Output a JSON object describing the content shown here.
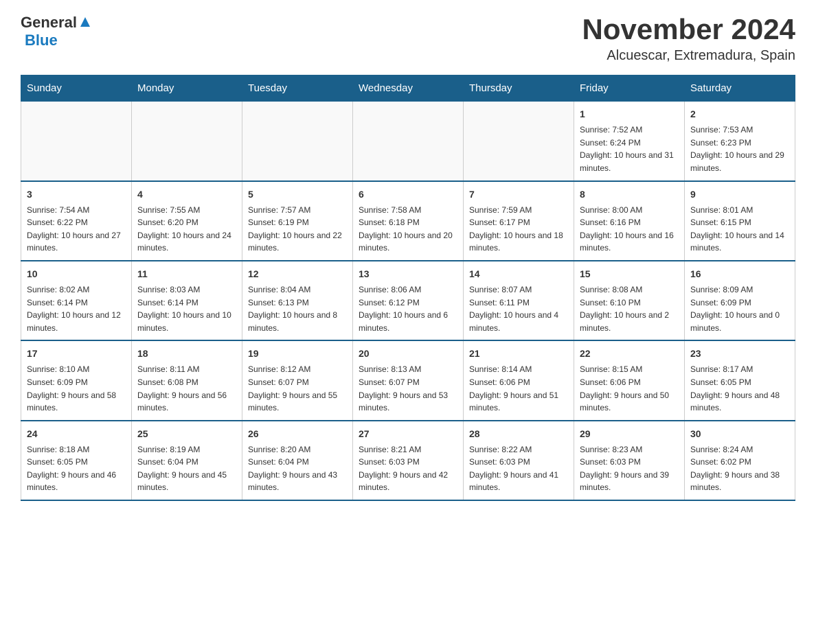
{
  "header": {
    "logo_general": "General",
    "logo_blue": "Blue",
    "title": "November 2024",
    "subtitle": "Alcuescar, Extremadura, Spain"
  },
  "calendar": {
    "days_of_week": [
      "Sunday",
      "Monday",
      "Tuesday",
      "Wednesday",
      "Thursday",
      "Friday",
      "Saturday"
    ],
    "weeks": [
      [
        {
          "day": "",
          "info": ""
        },
        {
          "day": "",
          "info": ""
        },
        {
          "day": "",
          "info": ""
        },
        {
          "day": "",
          "info": ""
        },
        {
          "day": "",
          "info": ""
        },
        {
          "day": "1",
          "info": "Sunrise: 7:52 AM\nSunset: 6:24 PM\nDaylight: 10 hours and 31 minutes."
        },
        {
          "day": "2",
          "info": "Sunrise: 7:53 AM\nSunset: 6:23 PM\nDaylight: 10 hours and 29 minutes."
        }
      ],
      [
        {
          "day": "3",
          "info": "Sunrise: 7:54 AM\nSunset: 6:22 PM\nDaylight: 10 hours and 27 minutes."
        },
        {
          "day": "4",
          "info": "Sunrise: 7:55 AM\nSunset: 6:20 PM\nDaylight: 10 hours and 24 minutes."
        },
        {
          "day": "5",
          "info": "Sunrise: 7:57 AM\nSunset: 6:19 PM\nDaylight: 10 hours and 22 minutes."
        },
        {
          "day": "6",
          "info": "Sunrise: 7:58 AM\nSunset: 6:18 PM\nDaylight: 10 hours and 20 minutes."
        },
        {
          "day": "7",
          "info": "Sunrise: 7:59 AM\nSunset: 6:17 PM\nDaylight: 10 hours and 18 minutes."
        },
        {
          "day": "8",
          "info": "Sunrise: 8:00 AM\nSunset: 6:16 PM\nDaylight: 10 hours and 16 minutes."
        },
        {
          "day": "9",
          "info": "Sunrise: 8:01 AM\nSunset: 6:15 PM\nDaylight: 10 hours and 14 minutes."
        }
      ],
      [
        {
          "day": "10",
          "info": "Sunrise: 8:02 AM\nSunset: 6:14 PM\nDaylight: 10 hours and 12 minutes."
        },
        {
          "day": "11",
          "info": "Sunrise: 8:03 AM\nSunset: 6:14 PM\nDaylight: 10 hours and 10 minutes."
        },
        {
          "day": "12",
          "info": "Sunrise: 8:04 AM\nSunset: 6:13 PM\nDaylight: 10 hours and 8 minutes."
        },
        {
          "day": "13",
          "info": "Sunrise: 8:06 AM\nSunset: 6:12 PM\nDaylight: 10 hours and 6 minutes."
        },
        {
          "day": "14",
          "info": "Sunrise: 8:07 AM\nSunset: 6:11 PM\nDaylight: 10 hours and 4 minutes."
        },
        {
          "day": "15",
          "info": "Sunrise: 8:08 AM\nSunset: 6:10 PM\nDaylight: 10 hours and 2 minutes."
        },
        {
          "day": "16",
          "info": "Sunrise: 8:09 AM\nSunset: 6:09 PM\nDaylight: 10 hours and 0 minutes."
        }
      ],
      [
        {
          "day": "17",
          "info": "Sunrise: 8:10 AM\nSunset: 6:09 PM\nDaylight: 9 hours and 58 minutes."
        },
        {
          "day": "18",
          "info": "Sunrise: 8:11 AM\nSunset: 6:08 PM\nDaylight: 9 hours and 56 minutes."
        },
        {
          "day": "19",
          "info": "Sunrise: 8:12 AM\nSunset: 6:07 PM\nDaylight: 9 hours and 55 minutes."
        },
        {
          "day": "20",
          "info": "Sunrise: 8:13 AM\nSunset: 6:07 PM\nDaylight: 9 hours and 53 minutes."
        },
        {
          "day": "21",
          "info": "Sunrise: 8:14 AM\nSunset: 6:06 PM\nDaylight: 9 hours and 51 minutes."
        },
        {
          "day": "22",
          "info": "Sunrise: 8:15 AM\nSunset: 6:06 PM\nDaylight: 9 hours and 50 minutes."
        },
        {
          "day": "23",
          "info": "Sunrise: 8:17 AM\nSunset: 6:05 PM\nDaylight: 9 hours and 48 minutes."
        }
      ],
      [
        {
          "day": "24",
          "info": "Sunrise: 8:18 AM\nSunset: 6:05 PM\nDaylight: 9 hours and 46 minutes."
        },
        {
          "day": "25",
          "info": "Sunrise: 8:19 AM\nSunset: 6:04 PM\nDaylight: 9 hours and 45 minutes."
        },
        {
          "day": "26",
          "info": "Sunrise: 8:20 AM\nSunset: 6:04 PM\nDaylight: 9 hours and 43 minutes."
        },
        {
          "day": "27",
          "info": "Sunrise: 8:21 AM\nSunset: 6:03 PM\nDaylight: 9 hours and 42 minutes."
        },
        {
          "day": "28",
          "info": "Sunrise: 8:22 AM\nSunset: 6:03 PM\nDaylight: 9 hours and 41 minutes."
        },
        {
          "day": "29",
          "info": "Sunrise: 8:23 AM\nSunset: 6:03 PM\nDaylight: 9 hours and 39 minutes."
        },
        {
          "day": "30",
          "info": "Sunrise: 8:24 AM\nSunset: 6:02 PM\nDaylight: 9 hours and 38 minutes."
        }
      ]
    ]
  }
}
